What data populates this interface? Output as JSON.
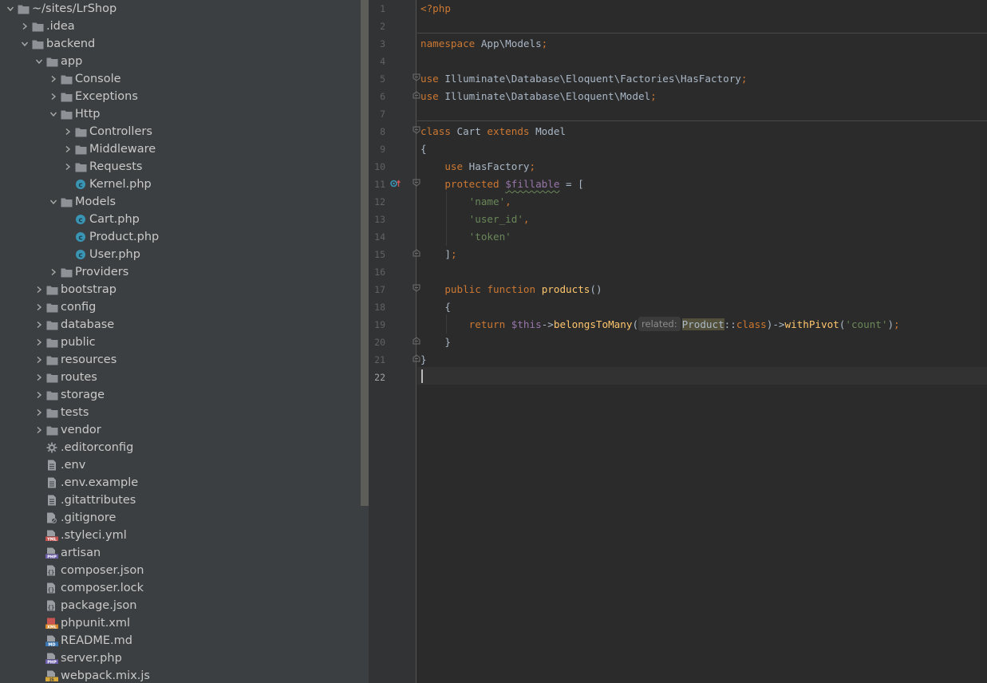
{
  "project_tree": {
    "items": [
      {
        "label": "~/sites/LrShop",
        "depth": 0,
        "type": "folder",
        "state": "expanded"
      },
      {
        "label": ".idea",
        "depth": 1,
        "type": "folder",
        "state": "collapsed"
      },
      {
        "label": "backend",
        "depth": 1,
        "type": "folder",
        "state": "expanded"
      },
      {
        "label": "app",
        "depth": 2,
        "type": "folder",
        "state": "expanded"
      },
      {
        "label": "Console",
        "depth": 3,
        "type": "folder",
        "state": "collapsed"
      },
      {
        "label": "Exceptions",
        "depth": 3,
        "type": "folder",
        "state": "collapsed"
      },
      {
        "label": "Http",
        "depth": 3,
        "type": "folder",
        "state": "expanded"
      },
      {
        "label": "Controllers",
        "depth": 4,
        "type": "folder",
        "state": "collapsed"
      },
      {
        "label": "Middleware",
        "depth": 4,
        "type": "folder",
        "state": "collapsed"
      },
      {
        "label": "Requests",
        "depth": 4,
        "type": "folder",
        "state": "collapsed"
      },
      {
        "label": "Kernel.php",
        "depth": 4,
        "type": "php-class",
        "state": "none"
      },
      {
        "label": "Models",
        "depth": 3,
        "type": "folder",
        "state": "expanded"
      },
      {
        "label": "Cart.php",
        "depth": 4,
        "type": "php-class",
        "state": "none"
      },
      {
        "label": "Product.php",
        "depth": 4,
        "type": "php-class",
        "state": "none"
      },
      {
        "label": "User.php",
        "depth": 4,
        "type": "php-class",
        "state": "none"
      },
      {
        "label": "Providers",
        "depth": 3,
        "type": "folder",
        "state": "collapsed"
      },
      {
        "label": "bootstrap",
        "depth": 2,
        "type": "folder",
        "state": "collapsed"
      },
      {
        "label": "config",
        "depth": 2,
        "type": "folder",
        "state": "collapsed"
      },
      {
        "label": "database",
        "depth": 2,
        "type": "folder",
        "state": "collapsed"
      },
      {
        "label": "public",
        "depth": 2,
        "type": "folder",
        "state": "collapsed"
      },
      {
        "label": "resources",
        "depth": 2,
        "type": "folder",
        "state": "collapsed"
      },
      {
        "label": "routes",
        "depth": 2,
        "type": "folder",
        "state": "collapsed"
      },
      {
        "label": "storage",
        "depth": 2,
        "type": "folder",
        "state": "collapsed"
      },
      {
        "label": "tests",
        "depth": 2,
        "type": "folder",
        "state": "collapsed"
      },
      {
        "label": "vendor",
        "depth": 2,
        "type": "folder",
        "state": "collapsed"
      },
      {
        "label": ".editorconfig",
        "depth": 2,
        "type": "gear-file",
        "state": "none"
      },
      {
        "label": ".env",
        "depth": 2,
        "type": "text-file",
        "state": "none"
      },
      {
        "label": ".env.example",
        "depth": 2,
        "type": "text-file",
        "state": "none"
      },
      {
        "label": ".gitattributes",
        "depth": 2,
        "type": "text-file",
        "state": "none"
      },
      {
        "label": ".gitignore",
        "depth": 2,
        "type": "ignore-file",
        "state": "none"
      },
      {
        "label": ".styleci.yml",
        "depth": 2,
        "type": "yml-file",
        "state": "none"
      },
      {
        "label": "artisan",
        "depth": 2,
        "type": "php-file",
        "state": "none"
      },
      {
        "label": "composer.json",
        "depth": 2,
        "type": "json-file",
        "state": "none"
      },
      {
        "label": "composer.lock",
        "depth": 2,
        "type": "json-file",
        "state": "none"
      },
      {
        "label": "package.json",
        "depth": 2,
        "type": "json-file",
        "state": "none"
      },
      {
        "label": "phpunit.xml",
        "depth": 2,
        "type": "xml-file",
        "state": "none"
      },
      {
        "label": "README.md",
        "depth": 2,
        "type": "md-file",
        "state": "none"
      },
      {
        "label": "server.php",
        "depth": 2,
        "type": "php-file",
        "state": "none"
      },
      {
        "label": "webpack.mix.js",
        "depth": 2,
        "type": "js-file",
        "state": "none"
      }
    ]
  },
  "editor": {
    "line_numbers": [
      "1",
      "2",
      "3",
      "4",
      "5",
      "6",
      "7",
      "8",
      "9",
      "10",
      "11",
      "12",
      "13",
      "14",
      "15",
      "16",
      "17",
      "18",
      "19",
      "20",
      "21",
      "22"
    ],
    "code": {
      "l1_open": "<?php",
      "l3_ns": "namespace",
      "l3_name": " App\\Models",
      "l3_semi": ";",
      "l5_use": "use",
      "l5_name": " Illuminate\\Database\\Eloquent\\Factories\\HasFactory",
      "l5_semi": ";",
      "l6_use": "use",
      "l6_name": " Illuminate\\Database\\Eloquent\\Model",
      "l6_semi": ";",
      "l8_class": "class",
      "l8_name": " Cart ",
      "l8_extends": "extends",
      "l8_parent": " Model",
      "l9": "{",
      "l10_indent": "    ",
      "l10_use": "use",
      "l10_name": " HasFactory",
      "l10_semi": ";",
      "l11_indent": "    ",
      "l11_protected": "protected",
      "l11_space": " ",
      "l11_var": "$fillable",
      "l11_rest": " = [",
      "l12_indent": "        ",
      "l12_str": "'name'",
      "l12_comma": ",",
      "l13_indent": "        ",
      "l13_str": "'user_id'",
      "l13_comma": ",",
      "l14_indent": "        ",
      "l14_str": "'token'",
      "l15_indent": "    ",
      "l15_close": "]",
      "l15_semi": ";",
      "l17_indent": "    ",
      "l17_public": "public",
      "l17_sp": " ",
      "l17_function": "function",
      "l17_sp2": " ",
      "l17_name": "products",
      "l17_parens": "()",
      "l18": "    {",
      "l19_indent": "        ",
      "l19_return": "return",
      "l19_sp": " ",
      "l19_this": "$this",
      "l19_arrow": "->",
      "l19_method": "belongsToMany",
      "l19_paren": "(",
      "l19_hint": "related:",
      "l19_product": "Product",
      "l19_dc": "::",
      "l19_class": "class",
      "l19_close": ")->",
      "l19_method2": "withPivot",
      "l19_paren2": "(",
      "l19_str": "'count'",
      "l19_end": ")",
      "l19_semi": ";",
      "l20": "    }",
      "l21": "}"
    }
  },
  "colors": {
    "keyword": "#cc7832",
    "string": "#6a8759",
    "variable": "#9876aa",
    "function": "#ffc66d",
    "text": "#a9b7c6",
    "folder_icon": "#8e9297",
    "php_class_icon": "#3a95b5"
  }
}
